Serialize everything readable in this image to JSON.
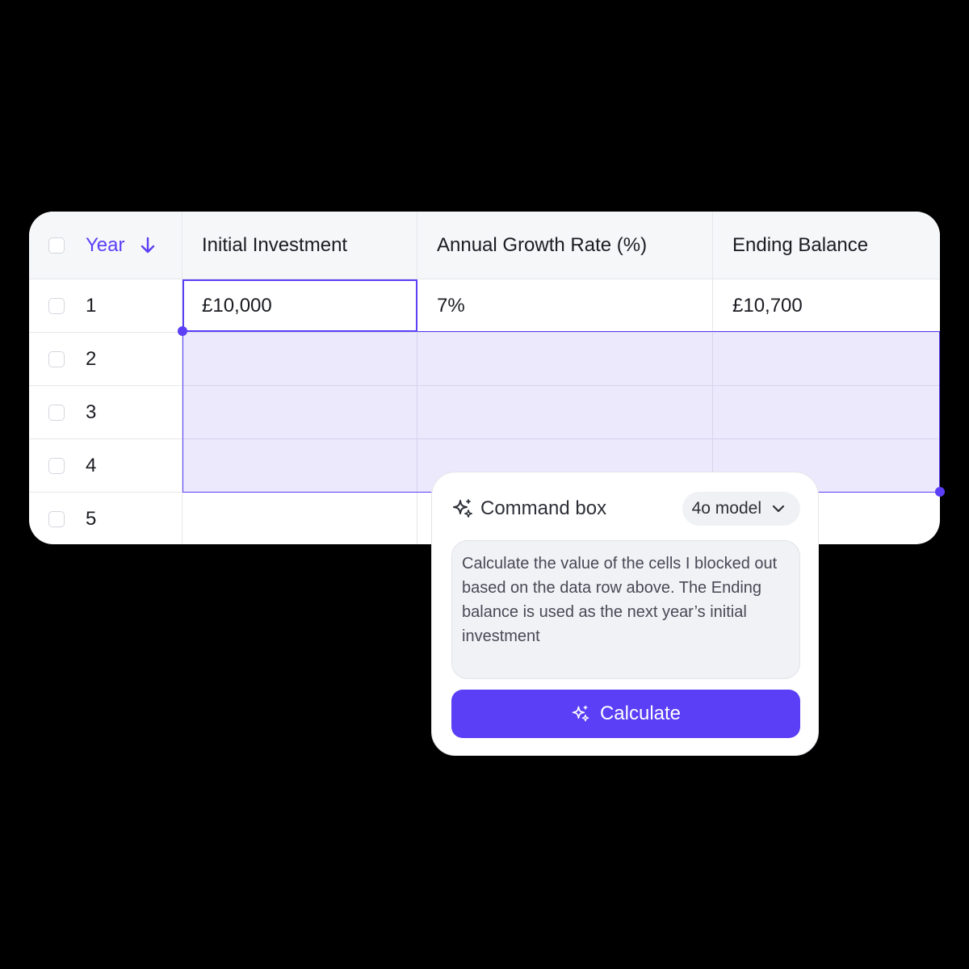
{
  "table": {
    "columns": {
      "year": "Year",
      "initial_investment": "Initial Investment",
      "growth_rate": "Annual Growth Rate (%)",
      "ending_balance": "Ending Balance"
    },
    "rows": [
      {
        "year": "1",
        "initial_investment": "£10,000",
        "growth_rate": "7%",
        "ending_balance": "£10,700"
      },
      {
        "year": "2",
        "initial_investment": "",
        "growth_rate": "",
        "ending_balance": ""
      },
      {
        "year": "3",
        "initial_investment": "",
        "growth_rate": "",
        "ending_balance": ""
      },
      {
        "year": "4",
        "initial_investment": "",
        "growth_rate": "",
        "ending_balance": ""
      },
      {
        "year": "5",
        "initial_investment": "",
        "growth_rate": "",
        "ending_balance": ""
      }
    ],
    "sort": {
      "column": "year",
      "direction": "descending",
      "icon": "arrow-down-icon"
    }
  },
  "command_box": {
    "title": "Command box",
    "title_icon": "sparkles-icon",
    "model_label": "4o model",
    "model_icon": "chevron-down-icon",
    "prompt_text": "Calculate the value of the cells I blocked out based on the data row above. The Ending balance is used as the next year’s initial investment",
    "button_label": "Calculate",
    "button_icon": "sparkles-icon"
  },
  "colors": {
    "accent": "#5a3ff6",
    "selection_fill": "#ece8fd",
    "background": "#000000",
    "card": "#ffffff",
    "header_bg": "#f6f7f9"
  }
}
